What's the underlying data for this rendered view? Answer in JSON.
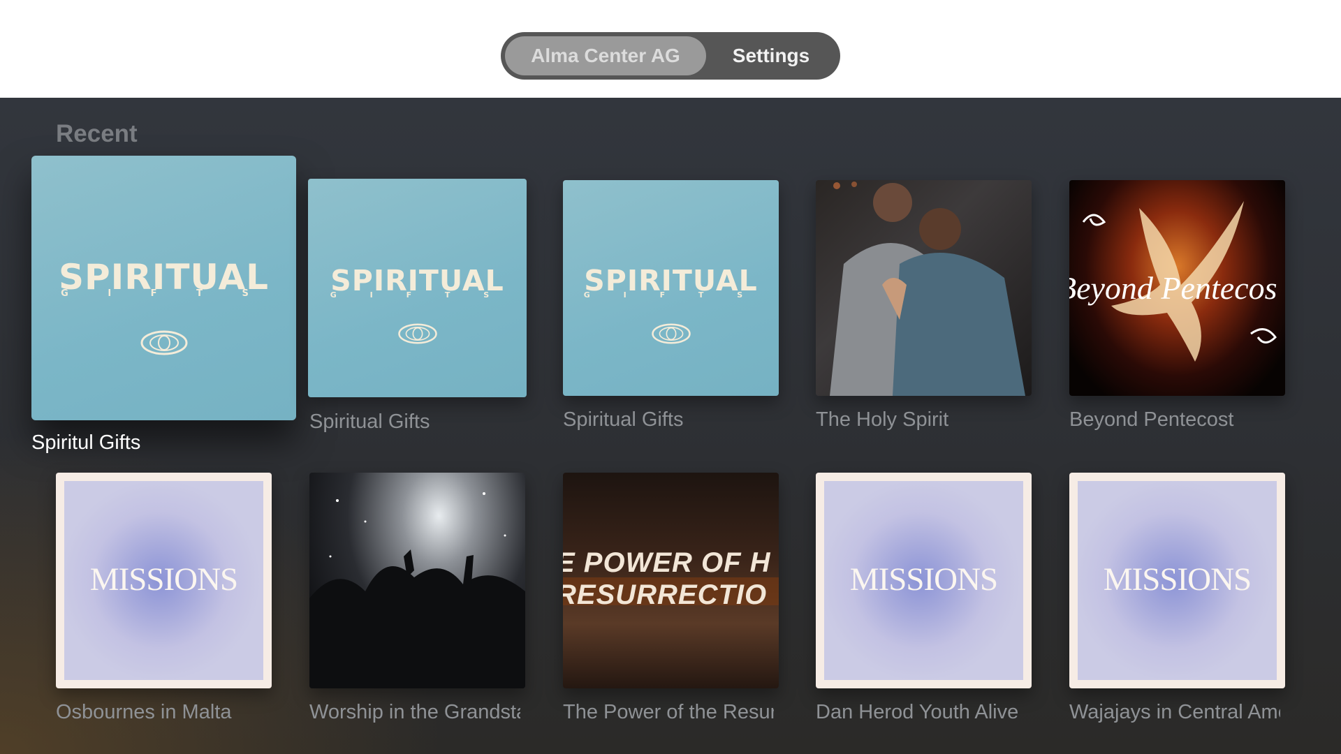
{
  "header": {
    "segments": [
      {
        "label": "Alma Center AG",
        "selected": true
      },
      {
        "label": "Settings",
        "selected": false
      }
    ]
  },
  "section": {
    "title": "Recent"
  },
  "tiles": [
    {
      "title": "Spiritul Gifts",
      "art": "spiritual",
      "art_text": "SPIRITUAL",
      "art_sub": "G I F T S",
      "focused": true
    },
    {
      "title": "Spiritual Gifts",
      "art": "spiritual",
      "art_text": "SPIRITUAL",
      "art_sub": "G I F T S"
    },
    {
      "title": "Spiritual Gifts",
      "art": "spiritual",
      "art_text": "SPIRITUAL",
      "art_sub": "G I F T S"
    },
    {
      "title": "The Holy Spirit",
      "art": "photo-men-praying"
    },
    {
      "title": "Beyond Pentecost",
      "art": "dove",
      "art_text": "Beyond Pentecos"
    },
    {
      "title": "Osbournes in Malta",
      "art": "missions",
      "art_text": "MISSIONS"
    },
    {
      "title": "Worship in the Grandstand",
      "art": "photo-worship"
    },
    {
      "title": "The Power of the Resurrection",
      "art": "power",
      "art_line1": "E POWER OF H",
      "art_line2": "RESURRECTIO"
    },
    {
      "title": "Dan Herod Youth Alive",
      "art": "missions",
      "art_text": "MISSIONS"
    },
    {
      "title": "Wajajays in Central America",
      "art": "missions",
      "art_text": "MISSIONS"
    }
  ],
  "colors": {
    "spiritual_bg": "#7bb6c7",
    "missions_bg": "#c3c2e3",
    "focused_title": "#ffffff",
    "title": "#8f9296"
  }
}
